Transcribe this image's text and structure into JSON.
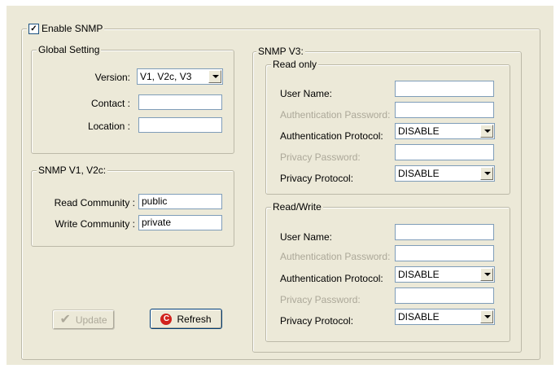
{
  "enable_snmp": {
    "label": "Enable SNMP",
    "checked": true,
    "check_glyph": "✓"
  },
  "global_setting": {
    "title": "Global Setting",
    "version_label": "Version:",
    "version_value": "V1, V2c, V3",
    "contact_label": "Contact :",
    "contact_value": "",
    "location_label": "Location :",
    "location_value": ""
  },
  "snmp_v1v2c": {
    "title": "SNMP V1, V2c:",
    "read_label": "Read Community :",
    "read_value": "public",
    "write_label": "Write Community :",
    "write_value": "private"
  },
  "snmp_v3": {
    "title": "SNMP V3:",
    "read_only": {
      "title": "Read only",
      "user_name_label": "User Name:",
      "user_name_value": "",
      "auth_password_label": "Authentication Password:",
      "auth_password_value": "",
      "auth_protocol_label": "Authentication Protocol:",
      "auth_protocol_value": "DISABLE",
      "privacy_password_label": "Privacy Password:",
      "privacy_password_value": "",
      "privacy_protocol_label": "Privacy Protocol:",
      "privacy_protocol_value": "DISABLE"
    },
    "read_write": {
      "title": "Read/Write",
      "user_name_label": "User Name:",
      "user_name_value": "",
      "auth_password_label": "Authentication Password:",
      "auth_password_value": "",
      "auth_protocol_label": "Authentication Protocol:",
      "auth_protocol_value": "DISABLE",
      "privacy_password_label": "Privacy Password:",
      "privacy_password_value": "",
      "privacy_protocol_label": "Privacy Protocol:",
      "privacy_protocol_value": "DISABLE"
    }
  },
  "buttons": {
    "update_label": "Update",
    "update_icon": "check-icon",
    "refresh_label": "Refresh",
    "refresh_icon": "refresh-icon"
  },
  "colors": {
    "panel_bg": "#ece9d8",
    "disabled_text": "#aca899",
    "field_border": "#7f9db9"
  }
}
